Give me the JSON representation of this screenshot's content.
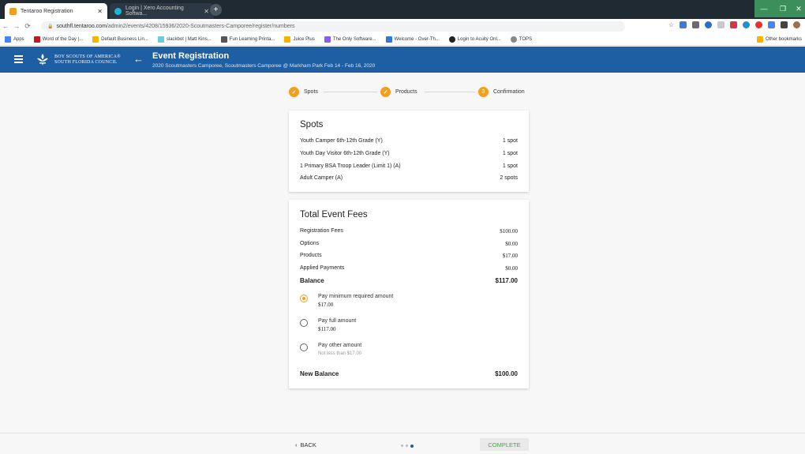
{
  "browser": {
    "tabs": [
      {
        "title": "Tentaroo Registration",
        "active": true,
        "favicon_color": "#f0a020"
      },
      {
        "title": "Login | Xero Accounting Softwa...",
        "active": false,
        "favicon_color": "#1ab4d7"
      }
    ],
    "new_tab_label": "+",
    "url_host": "southfl.tentaroo.com",
    "url_path": "/admin2/events/4208/15936/2020-Scoutmasters-Camporee/register/numbers",
    "bookmarks": [
      {
        "label": "Apps",
        "color": "#4285f4"
      },
      {
        "label": "Word of the Day |...",
        "color": "#c4161c"
      },
      {
        "label": "Default Business Lin...",
        "color": "#f4b400"
      },
      {
        "label": "slackbot | Matt Kins...",
        "color": "#6ecadc"
      },
      {
        "label": "Fun Learning Printa...",
        "color": "#555555"
      },
      {
        "label": "Juice Plus",
        "color": "#f4b400"
      },
      {
        "label": "The Only Software...",
        "color": "#8a5cf6"
      },
      {
        "label": "Welcome - Over-Th...",
        "color": "#2b7cd3"
      },
      {
        "label": "Login to Acuity Onl...",
        "color": "#222222"
      },
      {
        "label": "TOPS",
        "color": "#888888"
      }
    ],
    "other_bookmarks": "Other bookmarks"
  },
  "header": {
    "org_line1": "BOY SCOUTS OF AMERICA®",
    "org_line2": "SOUTH FLORIDA COUNCIL",
    "title": "Event Registration",
    "subtitle": "2020 Scoutmasters Camporee, Scoutmasters Camporee @ Markham Park Feb 14 - Feb 16, 2020"
  },
  "stepper": {
    "steps": [
      {
        "label": "Spots",
        "state": "done"
      },
      {
        "label": "Products",
        "state": "done"
      },
      {
        "label": "Confirmation",
        "state": "current",
        "number": "3"
      }
    ],
    "accent": "#f0a020"
  },
  "spots": {
    "title": "Spots",
    "items": [
      {
        "label": "Youth Camper 6th-12th Grade (Y)",
        "value": "1 spot"
      },
      {
        "label": "Youth Day Visitor 6th-12th Grade (Y)",
        "value": "1 spot"
      },
      {
        "label": "1 Primary BSA Troop Leader (Limit 1) (A)",
        "value": "1 spot"
      },
      {
        "label": "Adult Camper (A)",
        "value": "2 spots"
      }
    ]
  },
  "fees": {
    "title": "Total Event Fees",
    "items": [
      {
        "label": "Registration Fees",
        "value": "$100.00"
      },
      {
        "label": "Options",
        "value": "$0.00"
      },
      {
        "label": "Products",
        "value": "$17.00"
      },
      {
        "label": "Applied Payments",
        "value": "$0.00"
      }
    ],
    "balance_label": "Balance",
    "balance_value": "$117.00",
    "payment_options": [
      {
        "label": "Pay minimum required amount",
        "value": "$17.00",
        "selected": true
      },
      {
        "label": "Pay full amount",
        "value": "$117.00",
        "selected": false
      },
      {
        "label": "Pay other amount",
        "hint": "Not less than $17.00",
        "selected": false
      }
    ],
    "new_balance_label": "New Balance",
    "new_balance_value": "$100.00"
  },
  "footer": {
    "back_label": "BACK",
    "complete_label": "COMPLETE",
    "page_dots": 3,
    "active_dot": 3
  },
  "colors": {
    "brand_blue": "#1e5ea3",
    "accent_orange": "#f0a020",
    "complete_green": "#4aa84a"
  }
}
